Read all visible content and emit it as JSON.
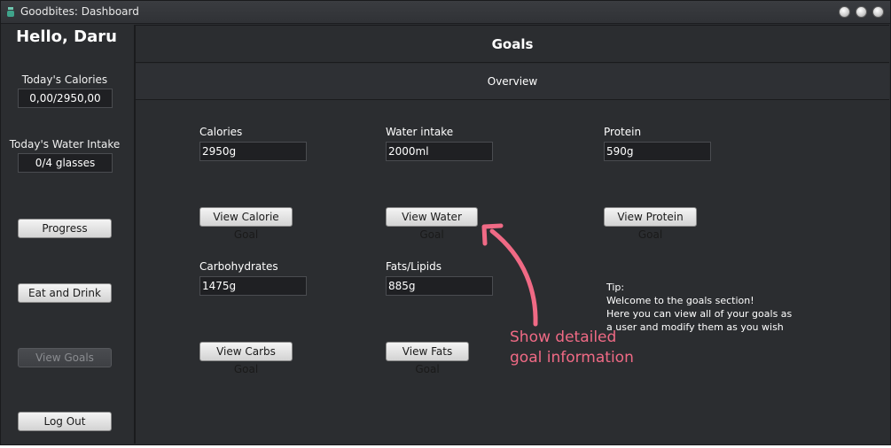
{
  "window": {
    "title": "Goodbites: Dashboard"
  },
  "sidebar": {
    "greeting": "Hello, Daru",
    "calories_label": "Today's Calories",
    "calories_value": "0,00/2950,00",
    "water_label": "Today's Water Intake",
    "water_value": "0/4 glasses",
    "buttons": {
      "progress": "Progress",
      "eat_drink": "Eat and Drink",
      "view_goals": "View Goals",
      "log_out": "Log Out"
    }
  },
  "main": {
    "header": "Goals",
    "tab": "Overview",
    "fields": {
      "calories": {
        "label": "Calories",
        "value": "2950g"
      },
      "water": {
        "label": "Water intake",
        "value": "2000ml"
      },
      "protein": {
        "label": "Protein",
        "value": "590g"
      },
      "carbs": {
        "label": "Carbohydrates",
        "value": "1475g"
      },
      "fats": {
        "label": "Fats/Lipids",
        "value": "885g"
      }
    },
    "buttons": {
      "calorie": "View Calorie Goal",
      "water": "View Water Goal",
      "protein": "View Protein Goal",
      "carbs": "View Carbs Goal",
      "fats": "View Fats Goal"
    },
    "tip": {
      "title": "Tip:",
      "line1": "Welcome to the goals section!",
      "line2": "Here you can view all of your goals as",
      "line3": "a user and modify them as you wish"
    }
  },
  "annotation": {
    "line1": "Show detailed",
    "line2": "goal information",
    "color": "#f06a85"
  },
  "colors": {
    "background": "#2b2d30",
    "field_background": "#1f2023",
    "button_background": "#e4e4e4"
  }
}
